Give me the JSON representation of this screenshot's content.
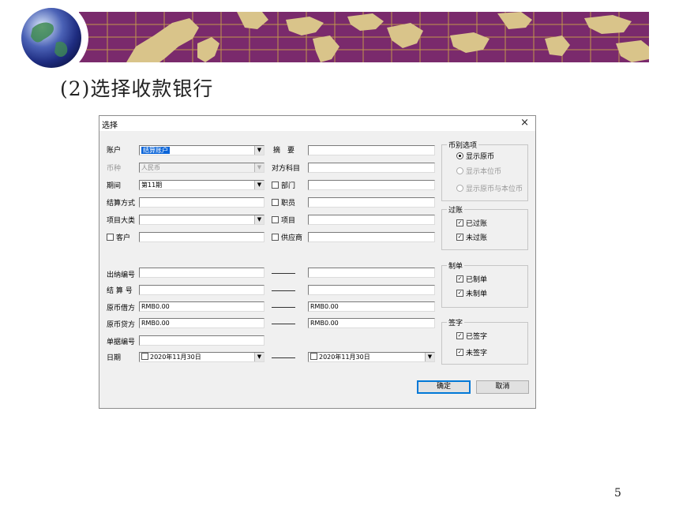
{
  "slide": {
    "title": "(2)选择收款银行",
    "page_number": "5"
  },
  "dialog": {
    "title": "选择",
    "close_symbol": "×",
    "labels": {
      "account": "账户",
      "currency": "币种",
      "period": "期间",
      "settle_method": "结算方式",
      "project_category": "项目大类",
      "customer": "客户",
      "summary": "摘　要",
      "counter_subject": "对方科目",
      "department": "部门",
      "staff": "职员",
      "project": "项目",
      "supplier": "供应商",
      "cashier_no": "出纳编号",
      "settle_no": "结 算 号",
      "orig_debit": "原币借方",
      "orig_credit": "原币贷方",
      "doc_no": "单据编号",
      "date": "日期"
    },
    "values": {
      "account": "结算账户",
      "currency": "人民币",
      "period": "第11期",
      "orig_debit_from": "RMB0.00",
      "orig_debit_to": "RMB0.00",
      "orig_credit_from": "RMB0.00",
      "orig_credit_to": "RMB0.00",
      "date_from": "2020年11月30日",
      "date_to": "2020年11月30日"
    },
    "currency_group": {
      "title": "币别选项",
      "options": [
        "显示原币",
        "显示本位币",
        "显示原币与本位币"
      ]
    },
    "posting_group": {
      "title": "过账",
      "options": [
        "已过账",
        "未过账"
      ]
    },
    "making_group": {
      "title": "制单",
      "options": [
        "已制单",
        "未制单"
      ]
    },
    "signing_group": {
      "title": "签字",
      "options": [
        "已签字",
        "未签字"
      ]
    },
    "buttons": {
      "ok": "确定",
      "cancel": "取消"
    }
  },
  "colors": {
    "banner": "#7a2a6c",
    "selection": "#0a64d8"
  },
  "icons": {
    "globe": "globe-icon",
    "dropdown": "chevron-down-icon",
    "close": "close-icon"
  }
}
